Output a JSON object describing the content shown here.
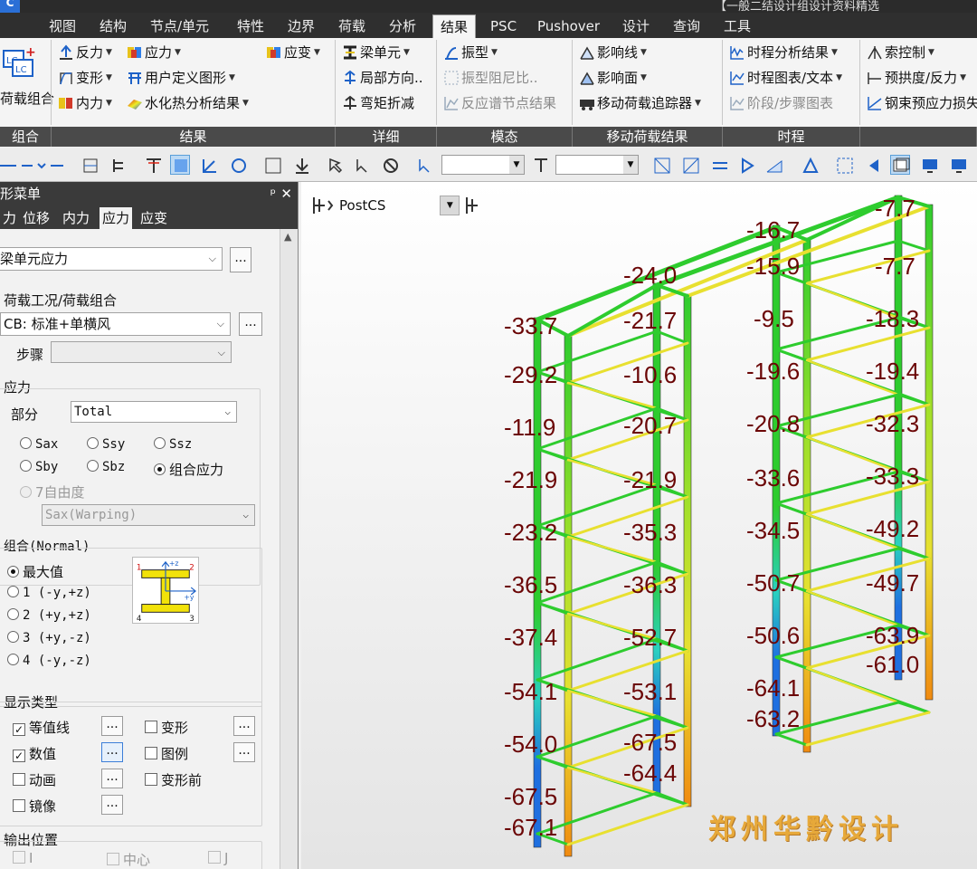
{
  "window": {
    "title": "【一般二结设计组设计资料精选"
  },
  "menu": {
    "tabs": [
      "视图",
      "结构",
      "节点/单元",
      "特性",
      "边界",
      "荷载",
      "分析",
      "结果",
      "PSC",
      "Pushover",
      "设计",
      "查询",
      "工具"
    ],
    "active_index": 7
  },
  "ribbon": {
    "load_combo_label": "荷载组合",
    "group_labels": [
      "组合",
      "结果",
      "详细",
      "模态",
      "移动荷载结果",
      "时程"
    ],
    "results": {
      "reaction": "反力",
      "stress": "应力",
      "deform_stress": "应变",
      "deformation": "变形",
      "user_defined": "用户定义图形",
      "internal_force": "内力",
      "hydration": "水化热分析结果"
    },
    "detail": {
      "beam_element": "梁单元",
      "local_dir": "局部方向..",
      "moment_reduction": "弯矩折减"
    },
    "modal": {
      "mode_shape": "振型",
      "mode_damping": "振型阻尼比..",
      "spectrum_node": "反应谱节点结果"
    },
    "moving": {
      "influence_line": "影响线",
      "influence_surface": "影响面",
      "tracker": "移动荷载追踪器"
    },
    "time_history": {
      "result": "时程分析结果",
      "graph_text": "时程图表/文本",
      "stage_step": "阶段/步骤图表"
    },
    "extra": {
      "cable_control": "索控制",
      "camber": "预拱度/反力",
      "tendon_loss": "钢束预应力损失"
    }
  },
  "left_panel": {
    "title": "形菜单",
    "tabs": [
      "力",
      "位移",
      "内力",
      "应力",
      "应变"
    ],
    "active_tab": 3,
    "result_type": "梁单元应力",
    "load_case_label": "荷载工况/荷载组合",
    "load_case_value": "CB: 标准+单横风",
    "step_label": "步骤",
    "stress_label": "应力",
    "part_label": "部分",
    "part_value": "Total",
    "options": [
      "Sax",
      "Ssy",
      "Ssz",
      "Sby",
      "Sbz",
      "组合应力"
    ],
    "seven_dof": "7自由度",
    "warping_value": "Sax(Warping)",
    "combo_title": "组合(Normal)",
    "combo_options": [
      "最大值",
      "1  (-y,+z)",
      "2  (+y,+z)",
      "3  (+y,-z)",
      "4  (-y,-z)"
    ],
    "section_marks": [
      "1",
      "2",
      "3",
      "4",
      "+z",
      "+y"
    ],
    "display_title": "显示类型",
    "display_items": [
      "等值线",
      "变形",
      "数值",
      "图例",
      "动画",
      "变形前",
      "镜像"
    ],
    "output_title": "输出位置",
    "output_items": [
      "I",
      "中心",
      "J"
    ]
  },
  "viewport": {
    "stage": "PostCS",
    "labels": [
      "-16.7",
      "-7.7",
      "-24.0",
      "-15.9",
      "-7.7",
      "-33.7",
      "-21.7",
      "-9.5",
      "-18.3",
      "-29.2",
      "-10.6",
      "-19.6",
      "-19.4",
      "-11.9",
      "-20.7",
      "-20.8",
      "-32.3",
      "-21.9",
      "-21.9",
      "-33.6",
      "-33.3",
      "-23.2",
      "-35.3",
      "-34.5",
      "-49.2",
      "-36.5",
      "-36.3",
      "-50.7",
      "-49.7",
      "-37.4",
      "-52.7",
      "-50.6",
      "-63.9",
      "-61.0",
      "-54.1",
      "-53.1",
      "-64.1",
      "-63.2",
      "-54.0",
      "-67.5",
      "-64.4",
      "-67.5",
      "-67.1"
    ],
    "watermark": "郑州华黔设计"
  },
  "colors": {
    "ribbon_dark": "#4a4a4a",
    "label": "#6b0606",
    "member_green": "#2ecc2e",
    "member_blue": "#1e6fe0",
    "member_yellow": "#e8e030",
    "member_orange": "#f08a10"
  }
}
